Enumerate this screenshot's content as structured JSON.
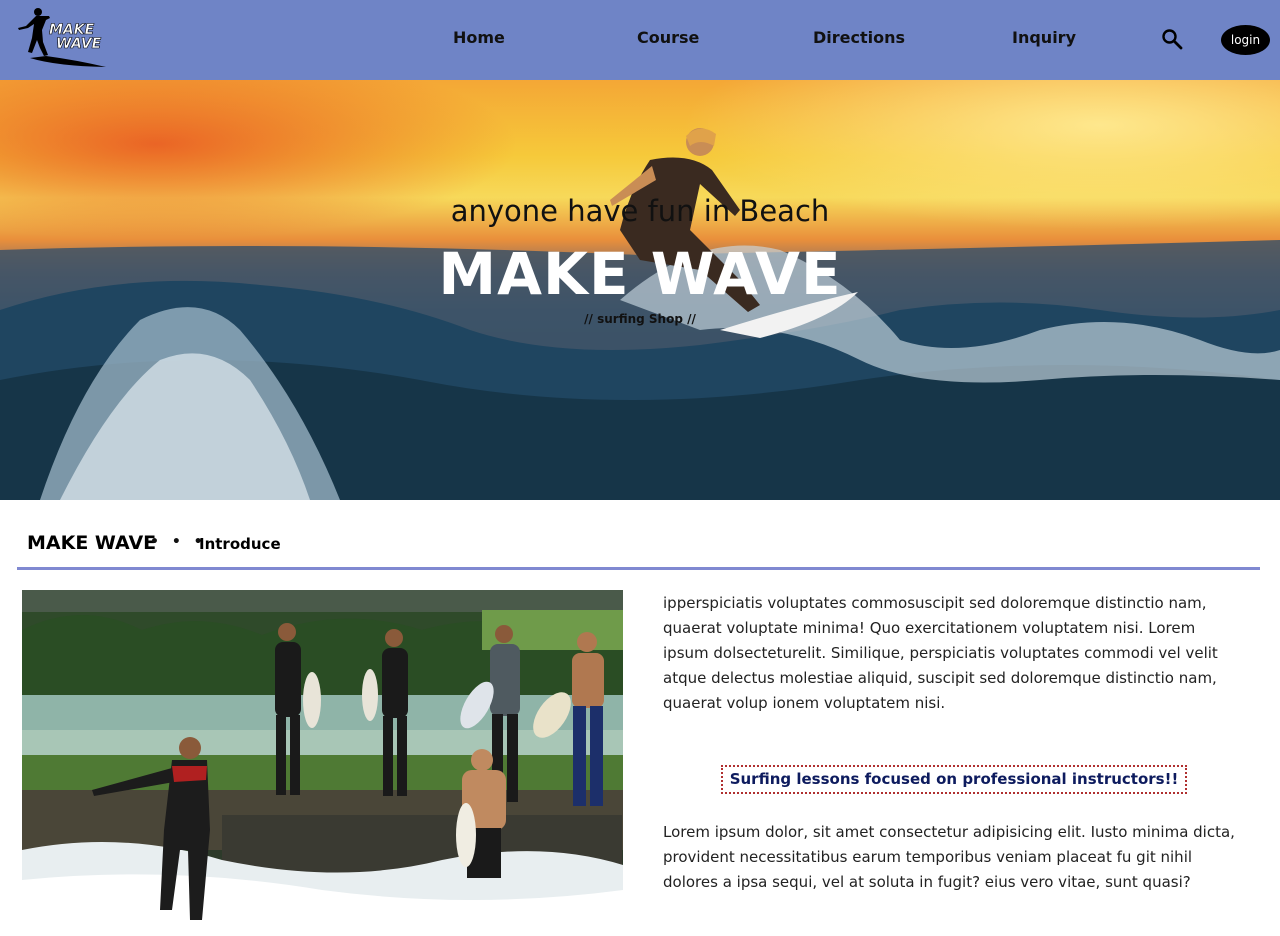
{
  "header": {
    "logo_text_line1": "MAKE",
    "logo_text_line2": "WAVE",
    "nav": [
      {
        "label": "Home"
      },
      {
        "label": "Course"
      },
      {
        "label": "Directions"
      },
      {
        "label": "Inquiry"
      }
    ],
    "search_icon": "search-icon",
    "login_label": "login",
    "background_color": "#6f84c6"
  },
  "hero": {
    "subtitle": "anyone have fun in Beach",
    "title": "MAKE WAVE",
    "tagline": "// surfing Shop //"
  },
  "section": {
    "title": "MAKE WAVE",
    "dots": "• • •",
    "subtitle": "Introduce",
    "underline_color": "#8089d1"
  },
  "content": {
    "paragraph1": "ipperspiciatis voluptates commosuscipit sed doloremque distinctio nam, quaerat voluptate minima! Quo exercitationem voluptatem nisi. Lorem ipsum dolsecteturelit. Similique, perspiciatis voluptates commodi vel velit atque delectus molestiae aliquid, suscipit sed doloremque distinctio nam, quaerat volup ionem voluptatem nisi.",
    "highlight": "Surfing lessons focused on professional instructors!!",
    "paragraph2": "Lorem ipsum dolor, sit amet consectetur adipisicing elit. Iusto minima dicta, provident necessitatibus earum temporibus veniam placeat fu git nihil dolores a ipsa sequi, vel at soluta in fugit? eius vero vitae, sunt quasi?"
  }
}
